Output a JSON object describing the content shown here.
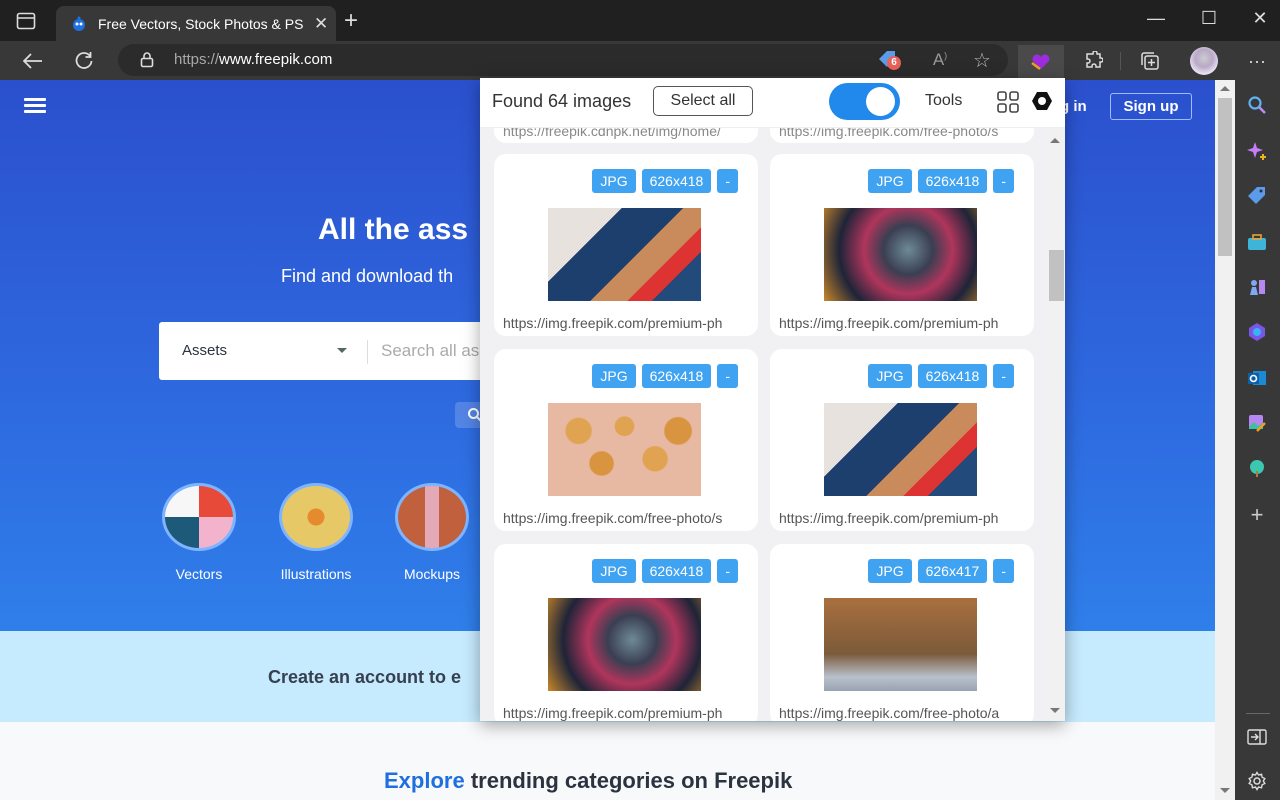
{
  "browser": {
    "tab": {
      "title": "Free Vectors, Stock Photos & PSD"
    },
    "address": {
      "protocol": "https://",
      "host": "www.freepik.com"
    },
    "coupon_badge_count": "6",
    "window_controls": {
      "minimize": "—",
      "maximize": "☐",
      "close": "✕"
    },
    "new_tab": "+",
    "more": "···"
  },
  "page": {
    "hero_title": "All the ass",
    "hero_subtitle": "Find and download th",
    "search": {
      "category": "Assets",
      "placeholder": "Search all as"
    },
    "login": "g in",
    "signup": "Sign up",
    "categories": [
      {
        "label": "Vectors"
      },
      {
        "label": "Illustrations"
      },
      {
        "label": "Mockups"
      }
    ],
    "banner_text": "Create an account to e",
    "explore_highlight": "Explore",
    "explore_rest": " trending categories on Freepik"
  },
  "popup": {
    "found_text": "Found 64 images",
    "select_all": "Select all",
    "toggle_on": true,
    "tools": "Tools",
    "partial_urls": [
      "https://freepik.cdnpk.net/img/home/",
      "https://img.freepik.com/free-photo/s"
    ],
    "cards": [
      {
        "format": "JPG",
        "size": "626x418",
        "extra": "-",
        "url": "https://img.freepik.com/premium-ph",
        "thumb": "couple"
      },
      {
        "format": "JPG",
        "size": "626x418",
        "extra": "-",
        "url": "https://img.freepik.com/premium-ph",
        "thumb": "mask"
      },
      {
        "format": "JPG",
        "size": "626x418",
        "extra": "-",
        "url": "https://img.freepik.com/free-photo/s",
        "thumb": "nuggets"
      },
      {
        "format": "JPG",
        "size": "626x418",
        "extra": "-",
        "url": "https://img.freepik.com/premium-ph",
        "thumb": "couple"
      },
      {
        "format": "JPG",
        "size": "626x418",
        "extra": "-",
        "url": "https://img.freepik.com/premium-ph",
        "thumb": "mask"
      },
      {
        "format": "JPG",
        "size": "626x417",
        "extra": "-",
        "url": "https://img.freepik.com/free-photo/a",
        "thumb": "football"
      }
    ]
  },
  "colors": {
    "accent": "#2188ec",
    "badge": "#3fa3f2",
    "hero": "#2b50cd",
    "banner": "#c6eafe",
    "explore": "#1f6fe0"
  }
}
